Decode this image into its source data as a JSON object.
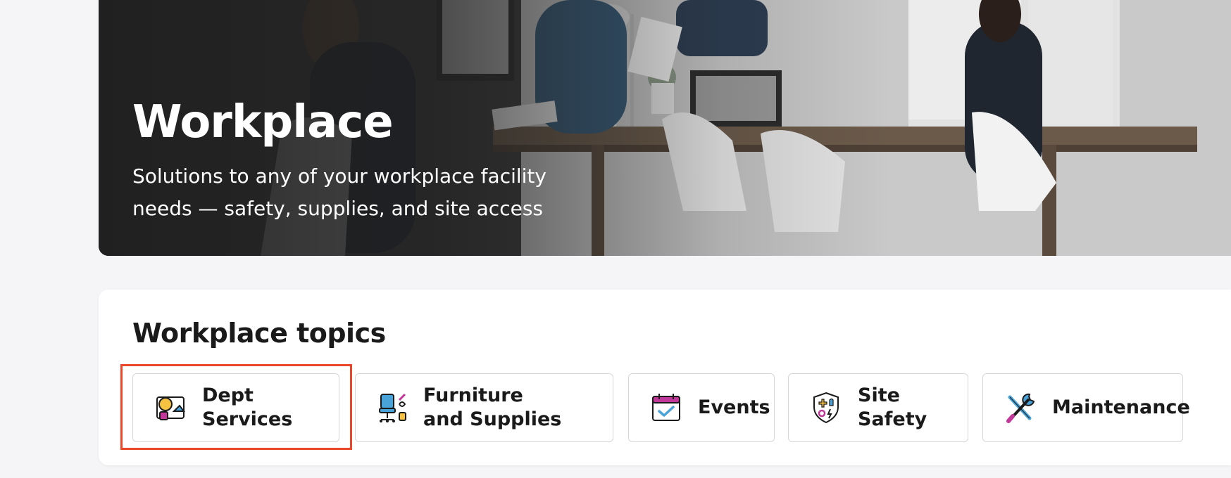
{
  "hero": {
    "title": "Workplace",
    "subtitle": "Solutions to any of your workplace facility needs — safety, supplies, and site access"
  },
  "topics": {
    "title": "Workplace topics",
    "items": [
      {
        "label": "Dept Services",
        "icon": "dept-services-icon",
        "selected": true
      },
      {
        "label": "Furniture and Supplies",
        "icon": "office-chair-icon"
      },
      {
        "label": "Events",
        "icon": "calendar-check-icon"
      },
      {
        "label": "Site Safety",
        "icon": "safety-shield-icon"
      },
      {
        "label": "Maintenance",
        "icon": "wrench-screwdriver-icon"
      }
    ]
  },
  "colors": {
    "highlight": "#e8472a",
    "accent_magenta": "#c2389a",
    "accent_blue": "#4aa3d8",
    "accent_yellow": "#f5c242"
  }
}
